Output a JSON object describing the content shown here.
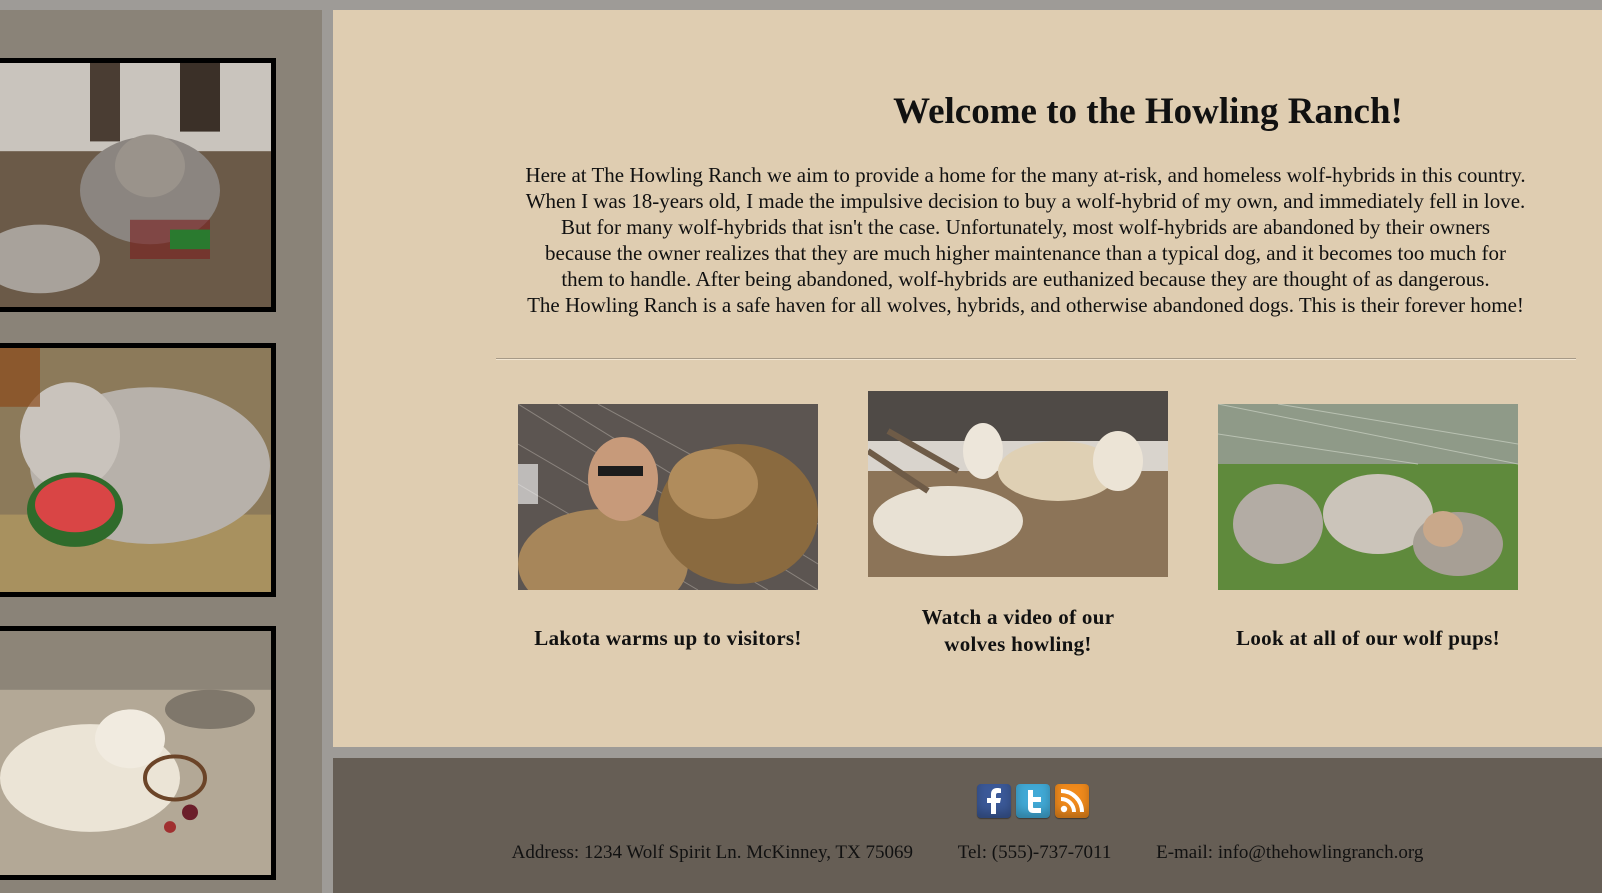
{
  "main": {
    "title": "Welcome to the Howling Ranch!",
    "intro_lines": [
      "Here at The Howling Ranch we aim to provide a home for the many at-risk, and homeless wolf-hybrids in this country.",
      "When I was 18-years old, I made the impulsive decision to buy a wolf-hybrid of my own, and immediately fell in love.",
      "But for many wolf-hybrids that isn't the case. Unfortunately, most wolf-hybrids are abandoned by their owners",
      "because the owner realizes that they are much higher maintenance than a typical dog, and it becomes too much for",
      "them to handle. After being abandoned, wolf-hybrids are euthanized because they are thought of as dangerous.",
      "The Howling Ranch is a safe haven for all wolves, hybrids, and otherwise abandoned dogs. This is their forever home!"
    ],
    "features": [
      {
        "caption": "Lakota warms up to visitors!",
        "image": "man-kissing-wolf-photo"
      },
      {
        "caption_line1": "Watch a video of our",
        "caption_line2": "wolves howling!",
        "image": "howling-wolves-photo"
      },
      {
        "caption": "Look at all of our wolf pups!",
        "image": "wolf-pups-photo"
      }
    ]
  },
  "sidebar": {
    "photos": [
      "wolf-pups-playing-photo",
      "wolf-eating-watermelon-photo",
      "white-wolf-with-basket-photo"
    ]
  },
  "footer": {
    "social": [
      {
        "name": "facebook-icon",
        "glyph": "f",
        "color": "#3b5998"
      },
      {
        "name": "twitter-icon",
        "glyph": "t",
        "color": "#41a9d6"
      },
      {
        "name": "rss-icon",
        "glyph": "rss",
        "color": "#f08a1c"
      }
    ],
    "address": "Address: 1234 Wolf Spirit Ln. McKinney, TX 75069",
    "tel": "Tel: (555)-737-7011",
    "email": "E-mail: info@thehowlingranch.org"
  },
  "colors": {
    "page_bg": "#9e9b97",
    "sidebar_bg": "#8a8378",
    "content_bg": "#dfcdb1",
    "footer_bg": "#665e55"
  }
}
